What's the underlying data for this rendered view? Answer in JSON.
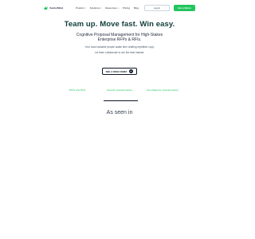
{
  "nav": {
    "logo_text": "VendorMind",
    "menu": [
      {
        "label": "Product",
        "has_dropdown": true
      },
      {
        "label": "Solutions",
        "has_dropdown": true
      },
      {
        "label": "Resources",
        "has_dropdown": true
      },
      {
        "label": "Pricing",
        "has_dropdown": false
      },
      {
        "label": "Blog",
        "has_dropdown": false
      }
    ],
    "login_label": "Log in",
    "demo_label": "Get a Demo"
  },
  "hero": {
    "title": "Team up. Move fast. Win easy.",
    "subtitle_line1": "Cognitive Proposal Management for High-Stakes",
    "subtitle_line2": "Enterprise RFPs & RFIs.",
    "line1": "Your most valuable people waste time drafting repetitive copy.",
    "line2": "Let them collaborate to win the deal instead.",
    "cta_label": "SEE A VIDEO DEMO"
  },
  "tabs": [
    {
      "label": "RFPs and RFIs"
    },
    {
      "label": "Security Questionnaires"
    },
    {
      "label": "Due Diligence Questionnaires"
    }
  ],
  "seen_in": "As seen in",
  "colors": {
    "accent": "#22c55e",
    "heading": "#0f3d3a"
  }
}
